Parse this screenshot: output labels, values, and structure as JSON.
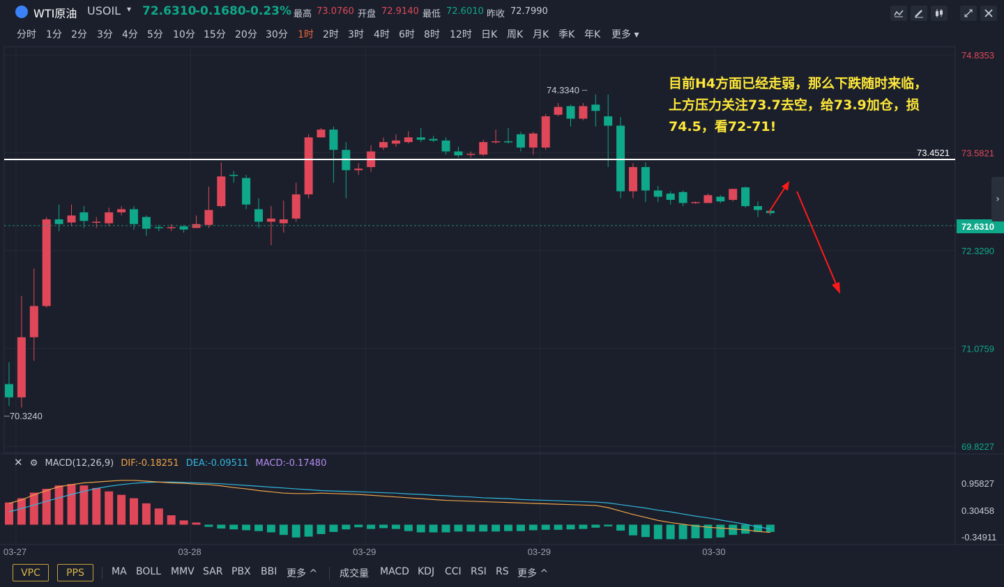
{
  "header": {
    "name": "WTI原油",
    "symbol": "USOIL",
    "price": "72.6310",
    "change": "-0.1680",
    "change_pct": "-0.23%",
    "high_label": "最高",
    "high": "73.0760",
    "open_label": "开盘",
    "open": "72.9140",
    "low_label": "最低",
    "low": "72.6010",
    "prev_label": "昨收",
    "prev": "72.7990"
  },
  "periods": [
    "分时",
    "1分",
    "2分",
    "3分",
    "4分",
    "5分",
    "10分",
    "15分",
    "20分",
    "30分",
    "1时",
    "2时",
    "3时",
    "4时",
    "6时",
    "8时",
    "12时",
    "日K",
    "周K",
    "月K",
    "季K",
    "年K",
    "更多"
  ],
  "active_period": "1时",
  "annotation": "目前H4方面已经走弱，那么下跌随时来临，上方压力关注73.7去空，给73.9加仓，损74.5，看72-71!",
  "macd_legend": {
    "title": "MACD(12,26,9)",
    "dif": "DIF:-0.18251",
    "dea": "DEA:-0.09511",
    "macd": "MACD:-0.17480"
  },
  "bottom": {
    "main_indicators": [
      "VPC",
      "PPS"
    ],
    "overlays": [
      "MA",
      "BOLL",
      "MMV",
      "SAR",
      "PBX",
      "BBI",
      "更多 ^"
    ],
    "sub_indicators": [
      "成交量",
      "MACD",
      "KDJ",
      "CCI",
      "RSI",
      "RS",
      "更多 ^"
    ]
  },
  "colors": {
    "up": "#e0485a",
    "down": "#0fa88a",
    "dif": "#f0a54a",
    "dea": "#31b8e0",
    "macd": "#b38cf0",
    "annot": "#ffe83a",
    "arrow": "#ff1a1a"
  },
  "chart_data": {
    "type": "candlestick",
    "y_axis_labels": [
      "74.8353",
      "73.5821",
      "72.3290",
      "71.0759",
      "69.8227"
    ],
    "ylim": [
      69.8227,
      74.8353
    ],
    "x_labels": [
      "03-27",
      "03-28",
      "03-29",
      "03-29",
      "03-30"
    ],
    "x_label_index": [
      1,
      15,
      29,
      43,
      57
    ],
    "horizontal_line": "73.4521",
    "current_price": "72.6310",
    "max_label": "74.3340",
    "min_label": "70.3240",
    "candles": [
      [
        70.62,
        70.45,
        70.9,
        70.34
      ],
      [
        70.45,
        71.22,
        71.75,
        70.32
      ],
      [
        71.22,
        71.62,
        72.1,
        70.92
      ],
      [
        71.62,
        72.73,
        72.76,
        71.6
      ],
      [
        72.73,
        72.67,
        72.92,
        72.58
      ],
      [
        72.69,
        72.78,
        72.92,
        72.64
      ],
      [
        72.82,
        72.71,
        72.9,
        72.62
      ],
      [
        72.69,
        72.7,
        72.76,
        72.62
      ],
      [
        72.68,
        72.82,
        72.88,
        72.64
      ],
      [
        72.82,
        72.86,
        72.9,
        72.78
      ],
      [
        72.86,
        72.67,
        72.9,
        72.6
      ],
      [
        72.76,
        72.61,
        72.78,
        72.52
      ],
      [
        72.63,
        72.62,
        72.66,
        72.58
      ],
      [
        72.62,
        72.63,
        72.67,
        72.58
      ],
      [
        72.64,
        72.6,
        72.66,
        72.56
      ],
      [
        72.62,
        72.67,
        72.78,
        72.62
      ],
      [
        72.66,
        72.85,
        73.15,
        72.62
      ],
      [
        72.9,
        73.28,
        73.46,
        72.88
      ],
      [
        73.3,
        73.29,
        73.35,
        73.2
      ],
      [
        73.26,
        72.92,
        73.3,
        72.86
      ],
      [
        72.86,
        72.7,
        73.0,
        72.62
      ],
      [
        72.7,
        72.74,
        72.9,
        72.4
      ],
      [
        72.68,
        72.73,
        72.97,
        72.56
      ],
      [
        72.74,
        73.05,
        73.2,
        72.7
      ],
      [
        73.05,
        73.78,
        73.82,
        73.0
      ],
      [
        73.78,
        73.88,
        73.9,
        73.78
      ],
      [
        73.88,
        73.62,
        73.92,
        73.2
      ],
      [
        73.62,
        73.36,
        73.72,
        73.0
      ],
      [
        73.36,
        73.38,
        73.45,
        73.3
      ],
      [
        73.4,
        73.6,
        73.68,
        73.34
      ],
      [
        73.65,
        73.72,
        73.78,
        73.62
      ],
      [
        73.7,
        73.74,
        73.82,
        73.66
      ],
      [
        73.72,
        73.78,
        73.86,
        73.7
      ],
      [
        73.78,
        73.75,
        73.9,
        73.72
      ],
      [
        73.76,
        73.74,
        73.8,
        73.72
      ],
      [
        73.74,
        73.6,
        73.78,
        73.56
      ],
      [
        73.6,
        73.55,
        73.66,
        73.52
      ],
      [
        73.56,
        73.57,
        73.6,
        73.52
      ],
      [
        73.56,
        73.72,
        73.75,
        73.54
      ],
      [
        73.72,
        73.73,
        73.88,
        73.7
      ],
      [
        73.73,
        73.72,
        73.9,
        73.7
      ],
      [
        73.82,
        73.65,
        73.85,
        73.6
      ],
      [
        73.65,
        73.83,
        73.85,
        73.56
      ],
      [
        73.65,
        74.05,
        74.08,
        73.62
      ],
      [
        74.07,
        74.17,
        74.22,
        74.05
      ],
      [
        74.18,
        74.02,
        74.2,
        73.92
      ],
      [
        74.02,
        74.18,
        74.22,
        74.0
      ],
      [
        74.2,
        74.12,
        74.33,
        73.92
      ],
      [
        74.05,
        73.93,
        74.33,
        73.4
      ],
      [
        73.93,
        73.09,
        74.04,
        73.0
      ],
      [
        73.09,
        73.4,
        73.45,
        73.0
      ],
      [
        73.4,
        73.1,
        73.46,
        72.95
      ],
      [
        73.1,
        73.02,
        73.16,
        72.95
      ],
      [
        73.06,
        72.98,
        73.09,
        72.92
      ],
      [
        73.08,
        72.94,
        73.1,
        72.9
      ],
      [
        72.95,
        72.95,
        72.96,
        72.93
      ],
      [
        72.94,
        73.04,
        73.06,
        72.94
      ],
      [
        73.02,
        72.96,
        73.04,
        72.94
      ],
      [
        72.98,
        73.12,
        73.12,
        72.96
      ],
      [
        73.14,
        72.9,
        73.15,
        72.88
      ],
      [
        72.9,
        72.85,
        72.96,
        72.76
      ],
      [
        72.84,
        72.81,
        72.84,
        72.78
      ]
    ],
    "macd_axis_labels": [
      "0.95827",
      "0.30458",
      "-0.34911"
    ],
    "macd_ylim": [
      -0.4,
      1.2
    ],
    "macd_hist": [
      0.52,
      0.62,
      0.75,
      0.84,
      0.92,
      0.95,
      0.92,
      0.86,
      0.78,
      0.7,
      0.62,
      0.5,
      0.38,
      0.22,
      0.1,
      0.05,
      -0.05,
      -0.09,
      -0.11,
      -0.13,
      -0.15,
      -0.18,
      -0.24,
      -0.3,
      -0.28,
      -0.22,
      -0.17,
      -0.11,
      -0.06,
      -0.1,
      -0.08,
      -0.1,
      -0.15,
      -0.18,
      -0.18,
      -0.18,
      -0.16,
      -0.16,
      -0.16,
      -0.16,
      -0.15,
      -0.15,
      -0.13,
      -0.12,
      -0.12,
      -0.11,
      -0.1,
      -0.07,
      -0.04,
      -0.14,
      -0.25,
      -0.29,
      -0.34,
      -0.34,
      -0.34,
      -0.32,
      -0.32,
      -0.3,
      -0.24,
      -0.21,
      -0.17,
      -0.17
    ],
    "dif": [
      0.5,
      0.58,
      0.7,
      0.8,
      0.89,
      0.94,
      0.98,
      1.0,
      1.02,
      1.04,
      1.04,
      1.02,
      1.0,
      0.98,
      0.97,
      0.95,
      0.94,
      0.91,
      0.87,
      0.84,
      0.8,
      0.77,
      0.74,
      0.73,
      0.73,
      0.74,
      0.73,
      0.72,
      0.71,
      0.69,
      0.67,
      0.65,
      0.63,
      0.61,
      0.59,
      0.57,
      0.56,
      0.55,
      0.54,
      0.53,
      0.52,
      0.51,
      0.5,
      0.49,
      0.48,
      0.47,
      0.46,
      0.45,
      0.4,
      0.32,
      0.24,
      0.17,
      0.1,
      0.05,
      0.01,
      -0.03,
      -0.06,
      -0.08,
      -0.1,
      -0.12,
      -0.16,
      -0.18
    ],
    "dea": [
      0.3,
      0.38,
      0.46,
      0.55,
      0.63,
      0.71,
      0.78,
      0.85,
      0.9,
      0.94,
      0.97,
      0.99,
      1.0,
      1.0,
      0.99,
      0.98,
      0.97,
      0.96,
      0.94,
      0.92,
      0.9,
      0.88,
      0.86,
      0.84,
      0.82,
      0.8,
      0.79,
      0.78,
      0.77,
      0.76,
      0.75,
      0.74,
      0.72,
      0.71,
      0.69,
      0.68,
      0.66,
      0.65,
      0.63,
      0.62,
      0.61,
      0.59,
      0.58,
      0.57,
      0.56,
      0.55,
      0.54,
      0.53,
      0.51,
      0.47,
      0.43,
      0.39,
      0.34,
      0.3,
      0.25,
      0.2,
      0.16,
      0.11,
      0.06,
      0.01,
      -0.05,
      -0.1
    ]
  }
}
